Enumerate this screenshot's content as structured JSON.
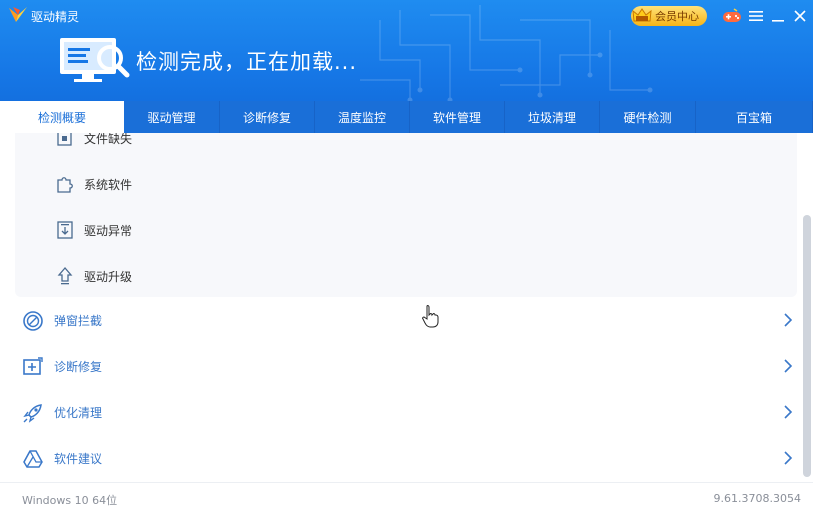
{
  "app": {
    "title": "驱动精灵",
    "vip_label": "会员中心"
  },
  "status": {
    "text": "检测完成，正在加载..."
  },
  "tabs": [
    {
      "label": "检测概要",
      "active": true
    },
    {
      "label": "驱动管理",
      "active": false
    },
    {
      "label": "诊断修复",
      "active": false
    },
    {
      "label": "温度监控",
      "active": false
    },
    {
      "label": "软件管理",
      "active": false
    },
    {
      "label": "垃圾清理",
      "active": false
    },
    {
      "label": "硬件检测",
      "active": false
    },
    {
      "label": "百宝箱",
      "active": false
    }
  ],
  "sub_items": [
    {
      "label": "文件缺失",
      "icon": "file-missing-icon"
    },
    {
      "label": "系统软件",
      "icon": "puzzle-icon"
    },
    {
      "label": "驱动异常",
      "icon": "driver-error-icon"
    },
    {
      "label": "驱动升级",
      "icon": "upgrade-arrow-icon"
    }
  ],
  "main_items": [
    {
      "label": "弹窗拦截",
      "icon": "block-icon"
    },
    {
      "label": "诊断修复",
      "icon": "repair-icon"
    },
    {
      "label": "优化清理",
      "icon": "rocket-icon"
    },
    {
      "label": "软件建议",
      "icon": "drive-icon"
    }
  ],
  "footer": {
    "os": "Windows 10 64位",
    "version": "9.61.3708.3054"
  },
  "colors": {
    "header_blue": "#1677e6",
    "tab_blue": "#1a6fd8",
    "link_blue": "#3a78c9",
    "vip_gold": "#f6b417"
  }
}
